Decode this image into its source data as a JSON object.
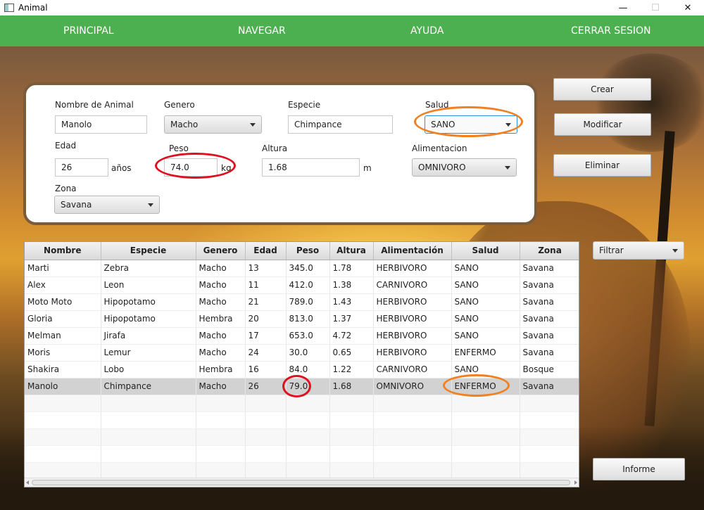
{
  "window": {
    "title": "Animal",
    "minimize": "—",
    "maximize": "☐",
    "close": "✕"
  },
  "menu": {
    "principal": "PRINCIPAL",
    "navegar": "NAVEGAR",
    "ayuda": "AYUDA",
    "cerrar": "CERRAR SESION"
  },
  "form": {
    "nombre_label": "Nombre de Animal",
    "nombre_value": "Manolo",
    "genero_label": "Genero",
    "genero_value": "Macho",
    "especie_label": "Especie",
    "especie_value": "Chimpance",
    "salud_label": "Salud",
    "salud_value": "SANO",
    "edad_label": "Edad",
    "edad_value": "26",
    "edad_unit": "años",
    "peso_label": "Peso",
    "peso_value": "74.0",
    "peso_unit": "kg",
    "altura_label": "Altura",
    "altura_value": "1.68",
    "altura_unit": "m",
    "alimentacion_label": "Alimentacion",
    "alimentacion_value": "OMNIVORO",
    "zona_label": "Zona",
    "zona_value": "Savana"
  },
  "buttons": {
    "crear": "Crear",
    "modificar": "Modificar",
    "eliminar": "Eliminar",
    "filtrar": "Filtrar",
    "informe": "Informe"
  },
  "table": {
    "headers": [
      "Nombre",
      "Especie",
      "Genero",
      "Edad",
      "Peso",
      "Altura",
      "Alimentación",
      "Salud",
      "Zona"
    ],
    "rows": [
      [
        "Marti",
        "Zebra",
        "Macho",
        "13",
        "345.0",
        "1.78",
        "HERBIVORO",
        "SANO",
        "Savana"
      ],
      [
        "Alex",
        "Leon",
        "Macho",
        "11",
        "412.0",
        "1.38",
        "CARNIVORO",
        "SANO",
        "Savana"
      ],
      [
        "Moto Moto",
        "Hipopotamo",
        "Macho",
        "21",
        "789.0",
        "1.43",
        "HERBIVORO",
        "SANO",
        "Savana"
      ],
      [
        "Gloria",
        "Hipopotamo",
        "Hembra",
        "20",
        "813.0",
        "1.37",
        "HERBIVORO",
        "SANO",
        "Savana"
      ],
      [
        "Melman",
        "Jirafa",
        "Macho",
        "17",
        "653.0",
        "4.72",
        "HERBIVORO",
        "SANO",
        "Savana"
      ],
      [
        "Moris",
        "Lemur",
        "Macho",
        "24",
        "30.0",
        "0.65",
        "HERBIVORO",
        "ENFERMO",
        "Savana"
      ],
      [
        "Shakira",
        "Lobo",
        "Hembra",
        "16",
        "84.0",
        "1.22",
        "CARNIVORO",
        "SANO",
        "Bosque"
      ],
      [
        "Manolo",
        "Chimpance",
        "Macho",
        "26",
        "79.0",
        "1.68",
        "OMNIVORO",
        "ENFERMO",
        "Savana"
      ]
    ],
    "selected_row": 7
  },
  "colors": {
    "menu_bar": "#4caf50",
    "annotation_orange": "#f08020",
    "annotation_red": "#e01020"
  }
}
